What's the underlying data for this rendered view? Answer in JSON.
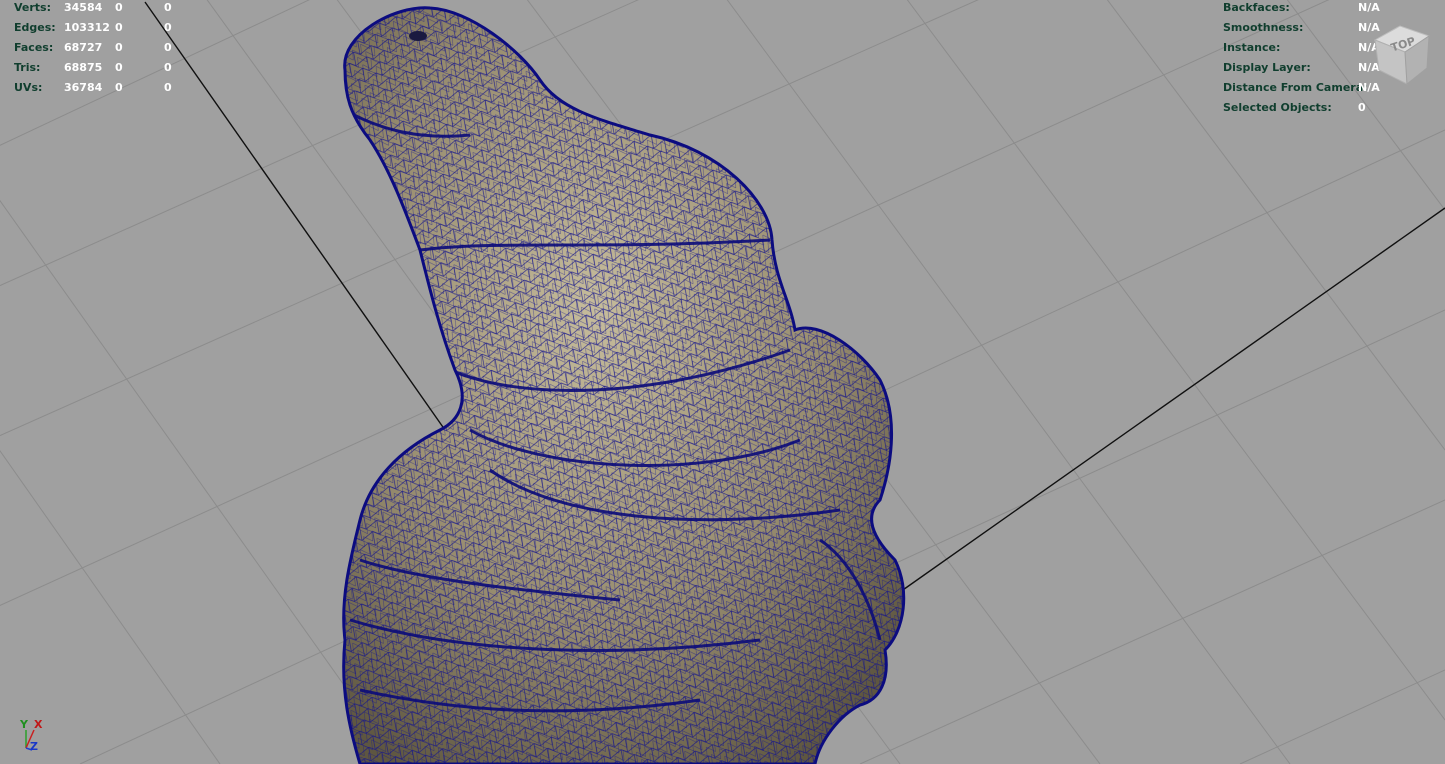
{
  "hud_left": {
    "rows": [
      {
        "label": "Verts:",
        "total": "34584",
        "selected": "0",
        "selected_tris": "0"
      },
      {
        "label": "Edges:",
        "total": "103312",
        "selected": "0",
        "selected_tris": "0"
      },
      {
        "label": "Faces:",
        "total": "68727",
        "selected": "0",
        "selected_tris": "0"
      },
      {
        "label": "Tris:",
        "total": "68875",
        "selected": "0",
        "selected_tris": "0"
      },
      {
        "label": "UVs:",
        "total": "36784",
        "selected": "0",
        "selected_tris": "0"
      }
    ]
  },
  "hud_right": {
    "rows": [
      {
        "label": "Backfaces:",
        "value": "N/A"
      },
      {
        "label": "Smoothness:",
        "value": "N/A"
      },
      {
        "label": "Instance:",
        "value": "N/A"
      },
      {
        "label": "Display Layer:",
        "value": "N/A"
      },
      {
        "label": "Distance From Camera:",
        "value": "N/A"
      },
      {
        "label": "Selected Objects:",
        "value": "0"
      }
    ]
  },
  "viewcube": {
    "face_label": "TOP",
    "icon": "view-cube-icon"
  },
  "axis_gizmo": {
    "y": "Y",
    "x": "X",
    "z": "Z",
    "icon": "axis-gizmo-icon"
  },
  "colors": {
    "viewport_background": "#a0a0a0",
    "grid_line": "#8a8a8a",
    "axis_line": "#101010",
    "mesh_fill": "#9a8f74",
    "mesh_highlight": "#c8bd9c",
    "wireframe": "#14148c",
    "hud_label": "#103e2e",
    "hud_value": "#ffffff"
  }
}
